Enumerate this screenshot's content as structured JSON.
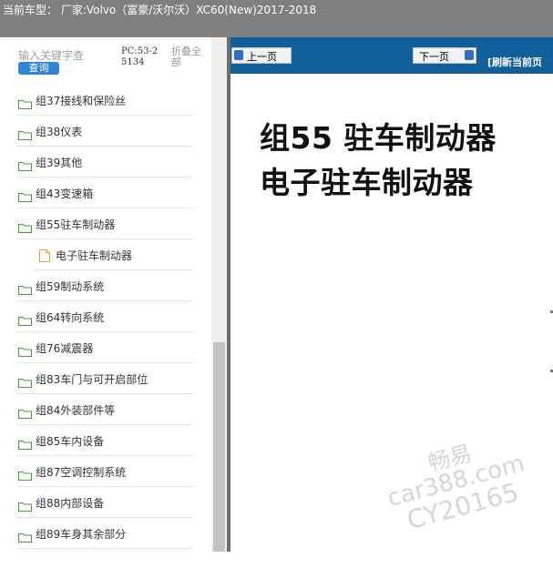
{
  "header": {
    "title": "当前车型：  厂家:Volvo（富豪/沃尔沃）XC60(New)2017-2018"
  },
  "search": {
    "placeholder": "输入关键字查",
    "button_label": "查询"
  },
  "pc_info": "PC:53-25134",
  "collapse_all_label": "折叠全部",
  "tree": [
    {
      "label": "组37接线和保险丝",
      "type": "folder",
      "level": 0
    },
    {
      "label": "组38仪表",
      "type": "folder",
      "level": 0
    },
    {
      "label": "组39其他",
      "type": "folder",
      "level": 0
    },
    {
      "label": "组43变速箱",
      "type": "folder",
      "level": 0
    },
    {
      "label": "组55驻车制动器",
      "type": "folder-open",
      "level": 0
    },
    {
      "label": "电子驻车制动器",
      "type": "document",
      "level": 1
    },
    {
      "label": "组59制动系统",
      "type": "folder",
      "level": 0
    },
    {
      "label": "组64转向系统",
      "type": "folder",
      "level": 0
    },
    {
      "label": "组76减震器",
      "type": "folder",
      "level": 0
    },
    {
      "label": "组83车门与可开启部位",
      "type": "folder",
      "level": 0
    },
    {
      "label": "组84外装部件等",
      "type": "folder",
      "level": 0
    },
    {
      "label": "组85车内设备",
      "type": "folder",
      "level": 0
    },
    {
      "label": "组87空调控制系统",
      "type": "folder",
      "level": 0
    },
    {
      "label": "组88内部设备",
      "type": "folder",
      "level": 0
    },
    {
      "label": "组89车身其余部分",
      "type": "folder",
      "level": 0
    }
  ],
  "nav": {
    "prev_label": "上一页",
    "next_label": "下一页",
    "refresh_label": "[刷新当前页"
  },
  "content": {
    "heading_line1": "组55 驻车制动器",
    "heading_line2": "电子驻车制动器"
  },
  "watermark": {
    "line1": "畅易",
    "line2": "car388.com",
    "line3": "CY20165"
  },
  "colors": {
    "topbar": "#7f7f7f",
    "nav_strip": "#0e5f9a",
    "query_button": "#2f86d9",
    "folder_icon": "#4a9a3a",
    "doc_icon": "#e8a030"
  }
}
